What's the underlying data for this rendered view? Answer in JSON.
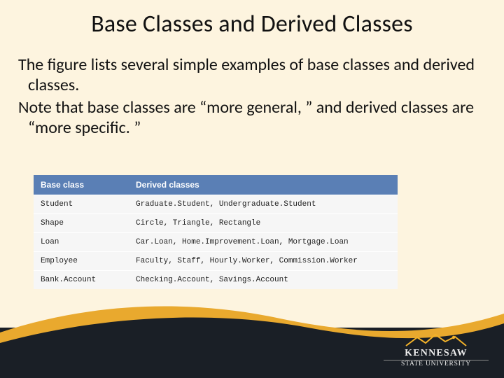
{
  "title": "Base Classes and Derived Classes",
  "body": {
    "p1": "The figure lists several simple examples of base classes and derived classes.",
    "p2": "Note that base classes are “more general, ” and derived classes are “more specific. ”"
  },
  "table": {
    "header": {
      "base": "Base class",
      "derived": "Derived classes"
    },
    "rows": [
      {
        "base": "Student",
        "derived": "Graduate.Student, Undergraduate.Student"
      },
      {
        "base": "Shape",
        "derived": "Circle, Triangle, Rectangle"
      },
      {
        "base": "Loan",
        "derived": "Car.Loan, Home.Improvement.Loan, Mortgage.Loan"
      },
      {
        "base": "Employee",
        "derived": "Faculty, Staff, Hourly.Worker, Commission.Worker"
      },
      {
        "base": "Bank.Account",
        "derived": "Checking.Account, Savings.Account"
      }
    ]
  },
  "logo": {
    "line1": "KENNESAW",
    "line2": "STATE UNIVERSITY"
  },
  "colors": {
    "slide_bg": "#fdf4df",
    "table_header": "#5a7fb5",
    "wave_gold": "#e9a92e",
    "wave_dark": "#1a1f26",
    "logo_gold": "#f3b229"
  }
}
